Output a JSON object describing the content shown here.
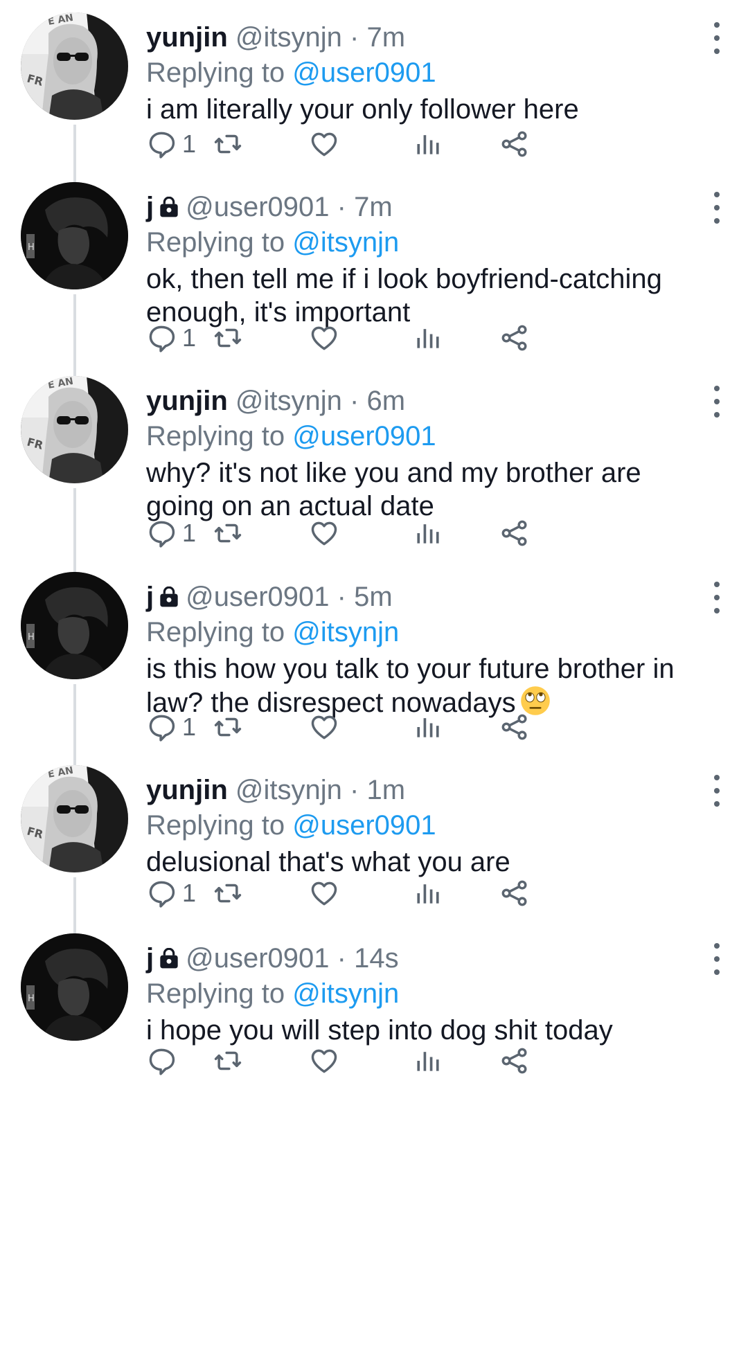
{
  "colors": {
    "accent": "#1d9bf0",
    "muted": "#6b7682",
    "text": "#141823",
    "icon": "#5b6570",
    "thread_line": "#d9dde1"
  },
  "icons": {
    "reply": "reply-icon",
    "retweet": "retweet-icon",
    "like": "heart-icon",
    "views": "analytics-icon",
    "share": "share-icon",
    "more": "more-vertical-icon",
    "lock": "lock-icon",
    "emoji": "face-with-rolling-eyes-emoji"
  },
  "tweets": [
    {
      "name": "yunjin",
      "handle": "@itsynjn",
      "sep": "·",
      "time": "7m",
      "replying_prefix": "Replying to",
      "reply_to": "@user0901",
      "text": "i am literally your only follower here",
      "reply_count": "1",
      "avatar": "yunjin-avatar",
      "locked": false,
      "emoji": ""
    },
    {
      "name": "j",
      "handle": "@user0901",
      "sep": "·",
      "time": "7m",
      "replying_prefix": "Replying to",
      "reply_to": "@itsynjn",
      "text": "ok, then tell me if i look boyfriend-catching enough, it's important",
      "reply_count": "1",
      "avatar": "j-avatar",
      "locked": true,
      "emoji": ""
    },
    {
      "name": "yunjin",
      "handle": "@itsynjn",
      "sep": "·",
      "time": "6m",
      "replying_prefix": "Replying to",
      "reply_to": "@user0901",
      "text": "why? it's not like you and my brother are going on an actual date",
      "reply_count": "1",
      "avatar": "yunjin-avatar",
      "locked": false,
      "emoji": ""
    },
    {
      "name": "j",
      "handle": "@user0901",
      "sep": "·",
      "time": "5m",
      "replying_prefix": "Replying to",
      "reply_to": "@itsynjn",
      "text": "is this how you talk to your future brother in law? the disrespect nowadays",
      "reply_count": "1",
      "avatar": "j-avatar",
      "locked": true,
      "emoji": "🙄"
    },
    {
      "name": "yunjin",
      "handle": "@itsynjn",
      "sep": "·",
      "time": "1m",
      "replying_prefix": "Replying to",
      "reply_to": "@user0901",
      "text": "delusional that's what you are",
      "reply_count": "1",
      "avatar": "yunjin-avatar",
      "locked": false,
      "emoji": ""
    },
    {
      "name": "j",
      "handle": "@user0901",
      "sep": "·",
      "time": "14s",
      "replying_prefix": "Replying to",
      "reply_to": "@itsynjn",
      "text": "i hope you will step into dog shit today",
      "reply_count": "",
      "avatar": "j-avatar",
      "locked": false,
      "emoji": ""
    }
  ]
}
